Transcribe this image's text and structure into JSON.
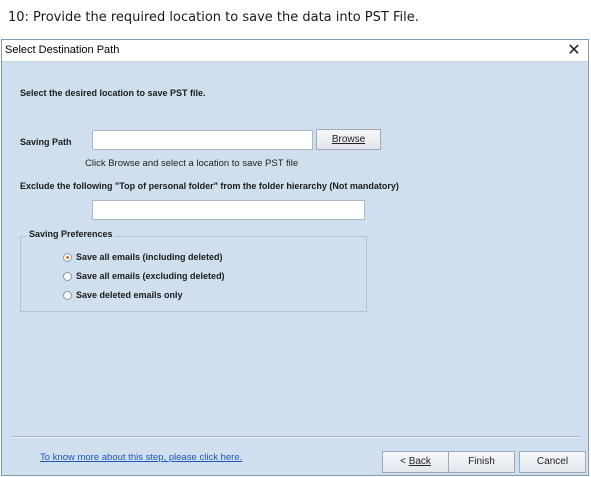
{
  "caption": "10: Provide the required location to save the data into PST File.",
  "dialog": {
    "title": "Select Destination Path",
    "close_glyph": "✕",
    "instruction": "Select the desired location to save PST file.",
    "saving_path_label": "Saving Path",
    "saving_path_value": "",
    "browse_label": "Browse",
    "browse_hint": "Click Browse and select a location to save PST file",
    "exclude_label": "Exclude the following \"Top of personal folder\" from the folder hierarchy  (Not mandatory)",
    "exclude_value": "",
    "preferences": {
      "title": "Saving Preferences",
      "options": [
        {
          "label": "Save all emails (including deleted)",
          "checked": true
        },
        {
          "label": "Save all emails (excluding deleted)",
          "checked": false
        },
        {
          "label": "Save deleted emails only",
          "checked": false
        }
      ]
    },
    "help_link": "To know more about this step, please click here.",
    "back_label": "Back",
    "back_prefix": "< ",
    "finish_label": "Finish",
    "cancel_label": "Cancel"
  },
  "colors": {
    "dialog_bg": "#cfdfee",
    "link": "#1a58b8",
    "radio_selected": "#e26b0a"
  },
  "icons": {
    "close": "close-icon",
    "radio": "radio-icon"
  }
}
